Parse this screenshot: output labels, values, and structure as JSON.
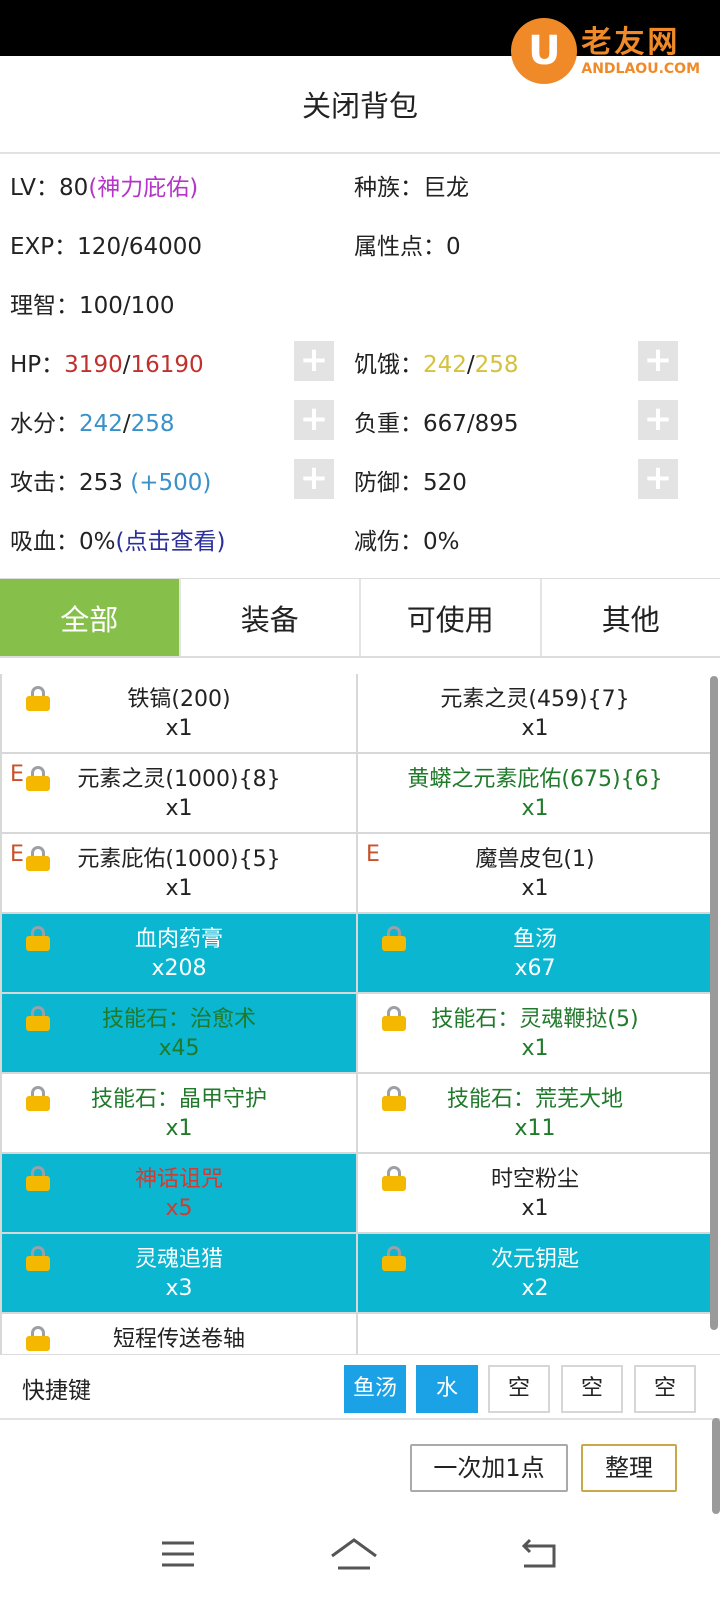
{
  "watermark": {
    "logo_letter": "U",
    "brand": "老友网",
    "domain": "ANDLAOU.COM"
  },
  "header": {
    "title": "关闭背包"
  },
  "stats": {
    "level_label": "LV：",
    "level_value": "80",
    "level_note": "(神力庇佑)",
    "race_label": "种族：",
    "race_value": "巨龙",
    "exp_label": "EXP：",
    "exp_value": "120/64000",
    "attr_points_label": "属性点：",
    "attr_points_value": "0",
    "sanity_label": "理智：",
    "sanity_value": "100/100",
    "hp_label": "HP：",
    "hp_current": "3190",
    "hp_sep": "/",
    "hp_max": "16190",
    "hunger_label": "饥饿：",
    "hunger_current": "242",
    "hunger_sep": "/",
    "hunger_max": "258",
    "water_label": "水分：",
    "water_current": "242",
    "water_sep": "/",
    "water_max": "258",
    "load_label": "负重：",
    "load_value": "667/895",
    "attack_label": "攻击：",
    "attack_value": "253",
    "attack_bonus": "(+500)",
    "defense_label": "防御：",
    "defense_value": "520",
    "lifesteal_label": "吸血：",
    "lifesteal_value": "0%",
    "lifesteal_link": "(点击查看)",
    "reduction_label": "减伤：",
    "reduction_value": "0%",
    "plus_symbol": "+"
  },
  "tabs": [
    {
      "label": "全部",
      "active": true
    },
    {
      "label": "装备",
      "active": false
    },
    {
      "label": "可使用",
      "active": false
    },
    {
      "label": "其他",
      "active": false
    }
  ],
  "items": [
    {
      "name": "铁镐(200)",
      "count": "x1",
      "lock": true,
      "e": false,
      "bg": "white",
      "color": "default"
    },
    {
      "name": "元素之灵(459){7}",
      "count": "x1",
      "lock": false,
      "e": false,
      "bg": "white",
      "color": "default"
    },
    {
      "name": "元素之灵(1000){8}",
      "count": "x1",
      "lock": true,
      "e": true,
      "bg": "white",
      "color": "default"
    },
    {
      "name": "黄蟒之元素庇佑(675){6}",
      "count": "x1",
      "lock": false,
      "e": false,
      "bg": "white",
      "color": "green"
    },
    {
      "name": "元素庇佑(1000){5}",
      "count": "x1",
      "lock": true,
      "e": true,
      "bg": "white",
      "color": "default"
    },
    {
      "name": "魔兽皮包(1)",
      "count": "x1",
      "lock": false,
      "e": true,
      "bg": "white",
      "color": "default"
    },
    {
      "name": "血肉药膏",
      "count": "x208",
      "lock": true,
      "e": false,
      "bg": "teal",
      "color": "default"
    },
    {
      "name": "鱼汤",
      "count": "x67",
      "lock": true,
      "e": false,
      "bg": "teal",
      "color": "default"
    },
    {
      "name": "技能石：治愈术",
      "count": "x45",
      "lock": true,
      "e": false,
      "bg": "teal",
      "color": "green"
    },
    {
      "name": "技能石：灵魂鞭挞(5)",
      "count": "x1",
      "lock": true,
      "e": false,
      "bg": "white",
      "color": "green"
    },
    {
      "name": "技能石：晶甲守护",
      "count": "x1",
      "lock": true,
      "e": false,
      "bg": "white",
      "color": "green"
    },
    {
      "name": "技能石：荒芜大地",
      "count": "x11",
      "lock": true,
      "e": false,
      "bg": "white",
      "color": "green"
    },
    {
      "name": "神话诅咒",
      "count": "x5",
      "lock": true,
      "e": false,
      "bg": "teal",
      "color": "red"
    },
    {
      "name": "时空粉尘",
      "count": "x1",
      "lock": true,
      "e": false,
      "bg": "white",
      "color": "default"
    },
    {
      "name": "灵魂追猎",
      "count": "x3",
      "lock": true,
      "e": false,
      "bg": "teal",
      "color": "default"
    },
    {
      "name": "次元钥匙",
      "count": "x2",
      "lock": true,
      "e": false,
      "bg": "teal",
      "color": "default"
    },
    {
      "name": "短程传送卷轴",
      "count": "",
      "lock": true,
      "e": false,
      "bg": "white",
      "color": "default"
    },
    {
      "name": "",
      "count": "",
      "lock": false,
      "e": false,
      "bg": "empty",
      "color": "default"
    }
  ],
  "e_badge": "E",
  "quickbar": {
    "label": "快捷键",
    "slots": [
      {
        "label": "鱼汤",
        "filled": true
      },
      {
        "label": "水",
        "filled": true
      },
      {
        "label": "空",
        "filled": false
      },
      {
        "label": "空",
        "filled": false
      },
      {
        "label": "空",
        "filled": false
      }
    ]
  },
  "actions": {
    "add_one_label": "一次加1点",
    "sort_label": "整理"
  },
  "colors": {
    "tab_active": "#86c04b",
    "item_teal": "#0ab6d0",
    "slot_filled": "#1aa1e6",
    "hp_red": "#c0312d",
    "hunger_yellow": "#d5c23c",
    "water_blue": "#3a91c9",
    "skill_green": "#1f7a2a",
    "brand_orange": "#f08a28"
  },
  "nav_icons": [
    "menu-icon",
    "home-icon",
    "back-icon"
  ]
}
